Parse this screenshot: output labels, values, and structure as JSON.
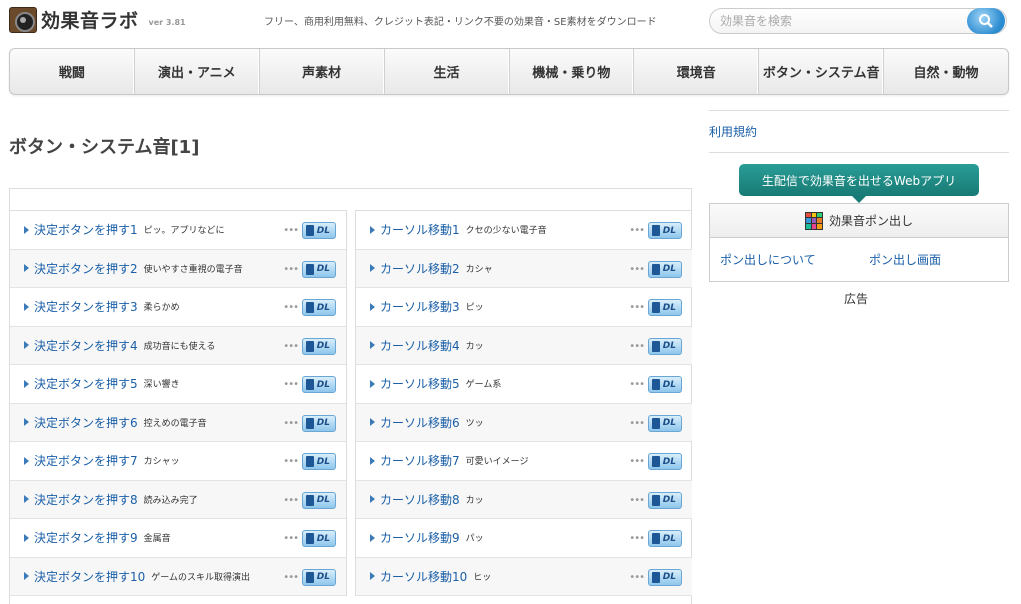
{
  "header": {
    "logo_text": "効果音ラボ",
    "version": "ver 3.81",
    "tagline": "フリー、商用利用無料、クレジット表記・リンク不要の効果音・SE素材をダウンロード",
    "search_placeholder": "効果音を検索"
  },
  "nav": {
    "items": [
      {
        "label": "戦闘"
      },
      {
        "label": "演出・アニメ"
      },
      {
        "label": "声素材"
      },
      {
        "label": "生活"
      },
      {
        "label": "機械・乗り物"
      },
      {
        "label": "環境音"
      },
      {
        "label": "ボタン・システム音"
      },
      {
        "label": "自然・動物"
      }
    ]
  },
  "main": {
    "page_title": "ボタン・システム音[1]",
    "download_label": "DL",
    "left_column": [
      {
        "title": "決定ボタンを押す1",
        "desc": "ピッ。アプリなどに"
      },
      {
        "title": "決定ボタンを押す2",
        "desc": "使いやすさ重視の電子音"
      },
      {
        "title": "決定ボタンを押す3",
        "desc": "柔らかめ"
      },
      {
        "title": "決定ボタンを押す4",
        "desc": "成功音にも使える"
      },
      {
        "title": "決定ボタンを押す5",
        "desc": "深い響き"
      },
      {
        "title": "決定ボタンを押す6",
        "desc": "控えめの電子音"
      },
      {
        "title": "決定ボタンを押す7",
        "desc": "カシャッ"
      },
      {
        "title": "決定ボタンを押す8",
        "desc": "読み込み完了"
      },
      {
        "title": "決定ボタンを押す9",
        "desc": "金属音"
      },
      {
        "title": "決定ボタンを押す10",
        "desc": "ゲームのスキル取得演出"
      }
    ],
    "right_column": [
      {
        "title": "カーソル移動1",
        "desc": "クセの少ない電子音"
      },
      {
        "title": "カーソル移動2",
        "desc": "カシャ"
      },
      {
        "title": "カーソル移動3",
        "desc": "ピッ"
      },
      {
        "title": "カーソル移動4",
        "desc": "カッ"
      },
      {
        "title": "カーソル移動5",
        "desc": "ゲーム系"
      },
      {
        "title": "カーソル移動6",
        "desc": "ツッ"
      },
      {
        "title": "カーソル移動7",
        "desc": "可愛いイメージ"
      },
      {
        "title": "カーソル移動8",
        "desc": "カッ"
      },
      {
        "title": "カーソル移動9",
        "desc": "パッ"
      },
      {
        "title": "カーソル移動10",
        "desc": "ヒッ"
      }
    ]
  },
  "sidebar": {
    "terms_link": "利用規約",
    "promo_label": "生配信で効果音を出せるWebアプリ",
    "pon_title": "効果音ポン出し",
    "pon_about": "ポン出しについて",
    "pon_screen": "ポン出し画面",
    "ad_label": "広告"
  },
  "colors": {
    "link": "#1a5fa8",
    "promo": "#187a74",
    "search_button": "#2a8bd0"
  }
}
